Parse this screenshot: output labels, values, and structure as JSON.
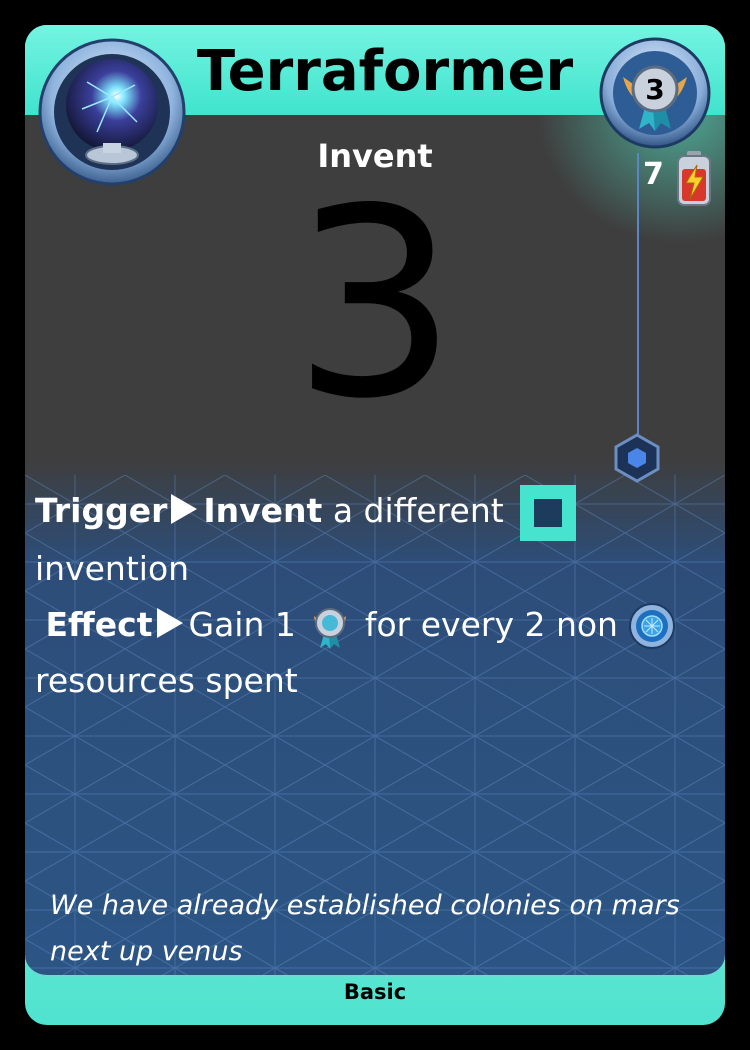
{
  "card": {
    "title": "Terraformer",
    "type_label": "Invent",
    "big_value": "3",
    "level_badge": "3",
    "energy_cost": "7",
    "rules": {
      "trigger_label": "Trigger",
      "trigger_keyword": "Invent",
      "trigger_text_1": "a different",
      "trigger_text_2": "invention",
      "effect_label": "Effect",
      "effect_text_1": "Gain 1",
      "effect_text_2": "for every 2 non",
      "effect_text_3": "resources spent"
    },
    "flavor_text": "We have already established colonies on mars next up venus",
    "rarity": "Basic",
    "icons": {
      "top_left": "plasma-orb-icon",
      "top_right": "level-badge-icon",
      "energy": "battery-icon",
      "invention_type": "square-invention-icon",
      "reward": "medal-icon",
      "resource": "blue-resource-icon",
      "connector": "hexagon-node-icon"
    },
    "colors": {
      "accent": "#46e4cf",
      "panel_dark": "#3e3e3e",
      "panel_blue": "#2c5585"
    }
  }
}
